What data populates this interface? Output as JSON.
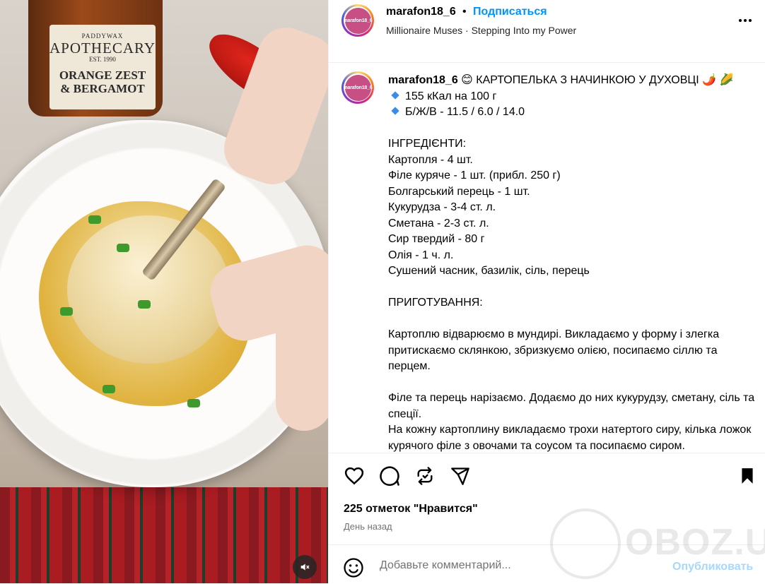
{
  "media": {
    "jar_label": {
      "line1": "PADDYWAX",
      "line2": "APOTHECARY",
      "line3": "EST. 1990",
      "line4a": "ORANGE ZEST",
      "line4b": "& BERGAMOT"
    },
    "mute_icon": "speaker-muted-icon"
  },
  "header": {
    "avatar_text": "marafon18_6",
    "username": "marafon18_6",
    "dot": "•",
    "follow_label": "Подписаться",
    "audio": "Millionaire Muses · Stepping Into my Power",
    "more_icon": "more-horizontal-icon"
  },
  "caption": {
    "avatar_text": "marafon18_6",
    "username": "marafon18_6",
    "title": "😊 КАРТОПЕЛЬКА З НАЧИНКОЮ У ДУХОВЦІ 🌶️ 🌽",
    "kcal": "155 кКал на 100 г",
    "bju": "Б/Ж/В - 11.5 / 6.0 / 14.0",
    "ingredients_header": "ІНГРЕДІЄНТИ:",
    "ingredients": [
      "Картопля - 4 шт.",
      "Філе куряче - 1 шт. (прибл. 250 г)",
      "Болгарський перець - 1 шт.",
      "Кукурудза - 3-4 ст. л.",
      "Сметана - 2-3 ст. л.",
      "Сир твердий - 80 г",
      "Олія - 1 ч. л.",
      "Сушений часник, базилік, сіль, перець"
    ],
    "prep_header": "ПРИГОТУВАННЯ:",
    "step1": "Картоплю відварюємо в мундирі. Викладаємо у форму і злегка притискаємо склянкою, збризкуємо олією, посипаємо сіллю та перцем.",
    "step2": "Філе та перець нарізаємо. Додаємо до них кукурудзу, сметану, сіль та спеції.",
    "step3": "На кожну картоплину викладаємо трохи натертого сиру, кілька ложок курячого філе з овочами та соусом та посипаємо сиром."
  },
  "actions": {
    "like_icon": "heart-icon",
    "comment_icon": "comment-icon",
    "repost_icon": "repost-icon",
    "share_icon": "send-icon",
    "save_icon": "bookmark-icon",
    "likes": "225 отметок \"Нравится\"",
    "time": "День назад"
  },
  "comment": {
    "placeholder": "Добавьте комментарий...",
    "post_label": "Опубликовать"
  },
  "watermark": {
    "text": "OBOZ.UA"
  },
  "colors": {
    "link": "#0095f6",
    "post_disabled": "#a8d7fb",
    "muted": "#737373"
  }
}
